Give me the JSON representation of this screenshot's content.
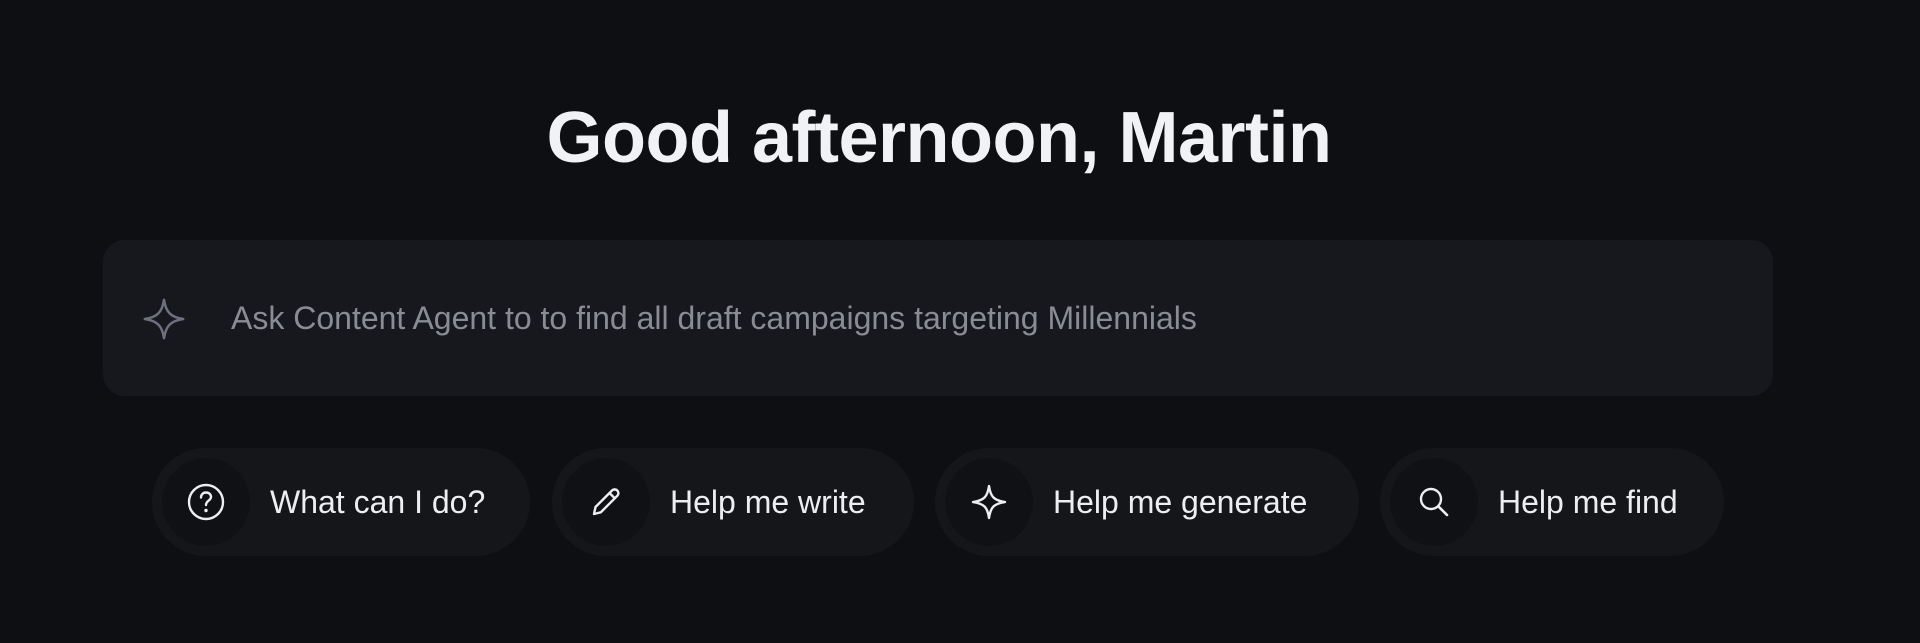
{
  "greeting": "Good afternoon, Martin",
  "prompt": {
    "placeholder": "Ask Content Agent to to find all draft campaigns targeting Millennials",
    "value": "",
    "icon": "sparkle-icon"
  },
  "suggestions": [
    {
      "label": "What can I do?",
      "icon": "help-circle-icon"
    },
    {
      "label": "Help me write",
      "icon": "pencil-icon"
    },
    {
      "label": "Help me generate",
      "icon": "sparkle-icon"
    },
    {
      "label": "Help me find",
      "icon": "search-icon"
    }
  ],
  "colors": {
    "background": "#0e0f13",
    "prompt_surface": "#17181d",
    "chip_surface": "#15161a",
    "text_primary": "#f1f2f5",
    "text_placeholder": "#8a8c94",
    "icon_muted": "#6e7080"
  }
}
